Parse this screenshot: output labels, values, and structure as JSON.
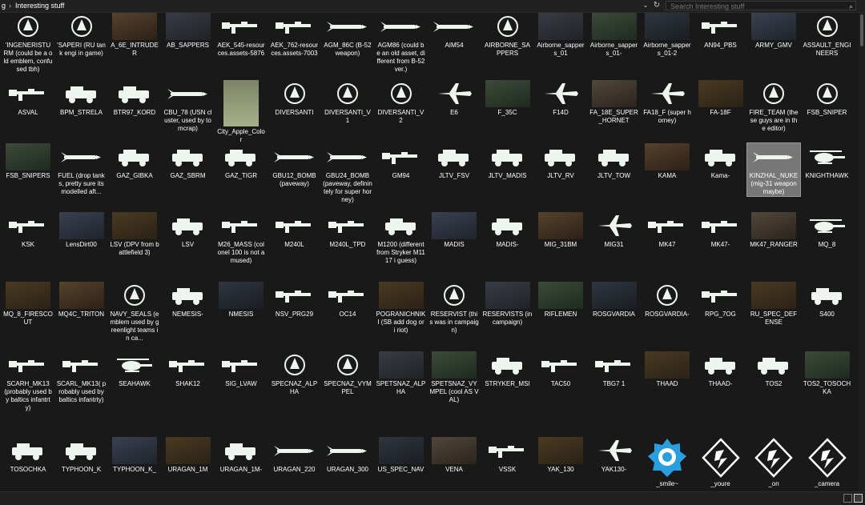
{
  "breadcrumb": {
    "parent": "g",
    "current": "Interesting stuff"
  },
  "search": {
    "placeholder": "Search Interesting stuff"
  },
  "items": [
    {
      "label": "'INGENERISTU RM (could be a old emblem, confused tbh)",
      "kind": "emblem"
    },
    {
      "label": "'SAPERI (RU tank engi in game)",
      "kind": "emblem"
    },
    {
      "label": "A_6E_INTRUDER",
      "kind": "photo"
    },
    {
      "label": "AB_SAPPERS",
      "kind": "photo"
    },
    {
      "label": "AEK_545-resources.assets-5876",
      "kind": "rifle"
    },
    {
      "label": "AEK_762-resources.assets-7003",
      "kind": "rifle"
    },
    {
      "label": "AGM_86C (B-52 weapon)",
      "kind": "missile"
    },
    {
      "label": "AGM86 (could be an old asset, different from B-52 ver.)",
      "kind": "missile"
    },
    {
      "label": "AIM54",
      "kind": "missile"
    },
    {
      "label": "AIRBORNE_SAPPERS",
      "kind": "emblem"
    },
    {
      "label": "Airborne_sappers_01",
      "kind": "photo"
    },
    {
      "label": "Airborne_sappers_01-",
      "kind": "photo"
    },
    {
      "label": "Airborne_sappers_01-2",
      "kind": "photo"
    },
    {
      "label": "AN94_PBS",
      "kind": "rifle"
    },
    {
      "label": "ARMY_GMV",
      "kind": "photo"
    },
    {
      "label": "ASSAULT_ENGINEERS",
      "kind": "emblem"
    },
    {
      "label": "ASVAL",
      "kind": "rifle"
    },
    {
      "label": "BPM_STRELA",
      "kind": "vehicle"
    },
    {
      "label": "BTR97_KORD",
      "kind": "vehicle"
    },
    {
      "label": "CBU_78 (USN cluster, used by tomcrap)",
      "kind": "missile"
    },
    {
      "label": "City_Apple_Color",
      "kind": "tall"
    },
    {
      "label": "DIVERSANTI",
      "kind": "emblem"
    },
    {
      "label": "DIVERSANTI_V1",
      "kind": "emblem"
    },
    {
      "label": "DIVERSANTI_V2",
      "kind": "emblem"
    },
    {
      "label": "E6",
      "kind": "aircraft"
    },
    {
      "label": "F_35C",
      "kind": "photo"
    },
    {
      "label": "F14D",
      "kind": "aircraft"
    },
    {
      "label": "FA_18E_SUPER_HORNET",
      "kind": "photo"
    },
    {
      "label": "FA18_F (super horney)",
      "kind": "aircraft"
    },
    {
      "label": "FA-18F",
      "kind": "photo"
    },
    {
      "label": "FIRE_TEAM (these guys are in the editor)",
      "kind": "emblem"
    },
    {
      "label": "FSB_SNIPER",
      "kind": "emblem"
    },
    {
      "label": "FSB_SNIPERS",
      "kind": "photo"
    },
    {
      "label": "FUEL (drop tanks, pretty sure its modelled aft...",
      "kind": "missile"
    },
    {
      "label": "GAZ_GIBKA",
      "kind": "vehicle"
    },
    {
      "label": "GAZ_SBRM",
      "kind": "vehicle"
    },
    {
      "label": "GAZ_TIGR",
      "kind": "vehicle"
    },
    {
      "label": "GBU12_BOMB (paveway)",
      "kind": "missile"
    },
    {
      "label": "GBU24_BOMB (paveway, definintely for super horney)",
      "kind": "missile"
    },
    {
      "label": "GM94",
      "kind": "rifle"
    },
    {
      "label": "JLTV_FSV",
      "kind": "vehicle"
    },
    {
      "label": "JLTV_MADIS",
      "kind": "vehicle"
    },
    {
      "label": "JLTV_RV",
      "kind": "vehicle"
    },
    {
      "label": "JLTV_TOW",
      "kind": "vehicle"
    },
    {
      "label": "KAMA",
      "kind": "photo"
    },
    {
      "label": "Kama-",
      "kind": "vehicle"
    },
    {
      "label": "KINZHAL_NUKE (mig-31 weapon maybe)",
      "kind": "missile",
      "selected": true
    },
    {
      "label": "KNIGHTHAWK",
      "kind": "heli"
    },
    {
      "label": "KSK",
      "kind": "rifle"
    },
    {
      "label": "LensDirt00",
      "kind": "photo"
    },
    {
      "label": "LSV (DPV from battlefield 3)",
      "kind": "photo"
    },
    {
      "label": "LSV",
      "kind": "vehicle"
    },
    {
      "label": "M26_MASS (colonel 100 is not amused)",
      "kind": "rifle"
    },
    {
      "label": "M240L",
      "kind": "rifle"
    },
    {
      "label": "M240L_TPD",
      "kind": "rifle"
    },
    {
      "label": "M1200 (different from Stryker M1117 i guess)",
      "kind": "vehicle"
    },
    {
      "label": "MADIS",
      "kind": "photo"
    },
    {
      "label": "MADIS-",
      "kind": "vehicle"
    },
    {
      "label": "MIG_31BM",
      "kind": "photo"
    },
    {
      "label": "MIG31",
      "kind": "aircraft"
    },
    {
      "label": "MK47",
      "kind": "rifle"
    },
    {
      "label": "MK47-",
      "kind": "rifle"
    },
    {
      "label": "MK47_RANGER",
      "kind": "photo"
    },
    {
      "label": "MQ_8",
      "kind": "heli"
    },
    {
      "label": "MQ_8_FIRESCOUT",
      "kind": "photo"
    },
    {
      "label": "MQ4C_TRITON",
      "kind": "photo"
    },
    {
      "label": "NAVY_SEALS (emblem used by greenlight teams in ca...",
      "kind": "emblem"
    },
    {
      "label": "NEMESIS-",
      "kind": "vehicle"
    },
    {
      "label": "NMESIS",
      "kind": "photo"
    },
    {
      "label": "NSV_PRG29",
      "kind": "rifle"
    },
    {
      "label": "OC14",
      "kind": "rifle"
    },
    {
      "label": "POGRANICHNIKI (SB add dog or i riot)",
      "kind": "photo"
    },
    {
      "label": "RESERVIST (this was in campaign)",
      "kind": "emblem"
    },
    {
      "label": "RESERVISTS (in campaign)",
      "kind": "photo"
    },
    {
      "label": "RIFLEMEN",
      "kind": "photo"
    },
    {
      "label": "ROSGVARDIA",
      "kind": "photo"
    },
    {
      "label": "ROSGVARDIA-",
      "kind": "emblem"
    },
    {
      "label": "RPG_7OG",
      "kind": "rifle"
    },
    {
      "label": "RU_SPEC_DEFENSE",
      "kind": "photo"
    },
    {
      "label": "S400",
      "kind": "vehicle"
    },
    {
      "label": "SCARH_MK13 (probably used by baltics infantrty)",
      "kind": "rifle"
    },
    {
      "label": "SCARL_MK13( probably used by baltics infantrty)",
      "kind": "rifle"
    },
    {
      "label": "SEAHAWK",
      "kind": "heli"
    },
    {
      "label": "SHAK12",
      "kind": "rifle"
    },
    {
      "label": "SIG_LVAW",
      "kind": "rifle"
    },
    {
      "label": "SPECNAZ_ALPHA",
      "kind": "emblem"
    },
    {
      "label": "SPECNAZ_VYMPEL",
      "kind": "emblem"
    },
    {
      "label": "SPETSNAZ_ALPHA",
      "kind": "photo"
    },
    {
      "label": "SPETSNAZ_VYMPEL (cool AS VAL)",
      "kind": "photo"
    },
    {
      "label": "STRYKER_MSI",
      "kind": "vehicle"
    },
    {
      "label": "TAC50",
      "kind": "rifle"
    },
    {
      "label": "TBG7 1",
      "kind": "rifle"
    },
    {
      "label": "THAAD",
      "kind": "photo"
    },
    {
      "label": "THAAD-",
      "kind": "vehicle"
    },
    {
      "label": "TOS2",
      "kind": "vehicle"
    },
    {
      "label": "TOS2_TOSOCHKA",
      "kind": "photo"
    },
    {
      "label": "TOSOCHKA",
      "kind": "vehicle"
    },
    {
      "label": "TYPHOON_K",
      "kind": "vehicle"
    },
    {
      "label": "TYPHOON_K_",
      "kind": "photo"
    },
    {
      "label": "URAGAN_1M",
      "kind": "photo"
    },
    {
      "label": "URAGAN_1M-",
      "kind": "vehicle"
    },
    {
      "label": "URAGAN_220",
      "kind": "missile"
    },
    {
      "label": "URAGAN_300",
      "kind": "missile"
    },
    {
      "label": "US_SPEC_NAV",
      "kind": "photo"
    },
    {
      "label": "VENA",
      "kind": "photo"
    },
    {
      "label": "VSSK",
      "kind": "rifle"
    },
    {
      "label": "YAK_130",
      "kind": "photo"
    },
    {
      "label": "YAK130-",
      "kind": "aircraft"
    },
    {
      "label": "_smile~",
      "kind": "badge_blue"
    },
    {
      "label": "_youre",
      "kind": "badge"
    },
    {
      "label": "_on",
      "kind": "badge"
    },
    {
      "label": "_camera",
      "kind": "badge"
    }
  ],
  "colors": {
    "background": "#191919",
    "icon_light": "#eef5ee",
    "badge_blue": "#2a9fe0",
    "selected": "#777777"
  }
}
